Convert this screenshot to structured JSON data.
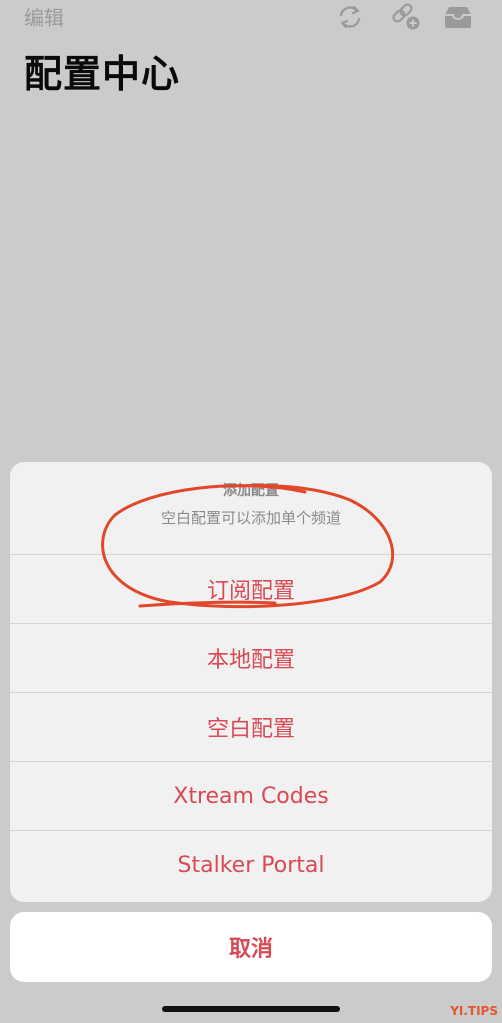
{
  "header": {
    "edit_label": "编辑",
    "title": "配置中心"
  },
  "icons": {
    "refresh": "refresh-icon",
    "link_add": "link-add-icon",
    "inbox": "inbox-icon"
  },
  "sheet": {
    "title": "添加配置",
    "message": "空白配置可以添加单个频道",
    "options": [
      "订阅配置",
      "本地配置",
      "空白配置",
      "Xtream Codes",
      "Stalker Portal"
    ],
    "cancel_label": "取消"
  },
  "watermark": "YI.TIPS",
  "colors": {
    "background": "#cbcbcb",
    "sheet": "#f1f1f1",
    "accent": "#d94a54",
    "annotation": "#e2472b"
  }
}
